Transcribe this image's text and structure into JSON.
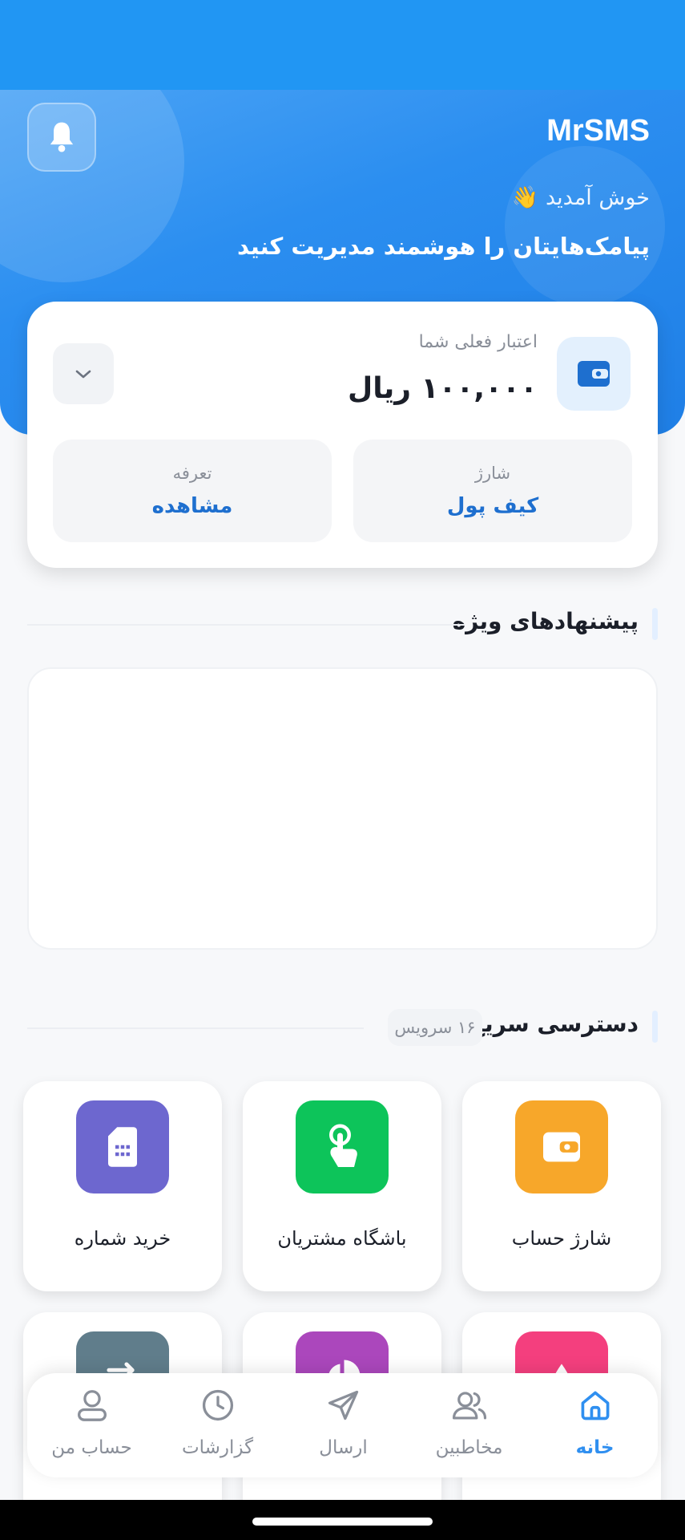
{
  "header": {
    "brand": "MrSMS",
    "welcome": "خوش آمدید 👋",
    "tagline": "پیامک‌هایتان را هوشمند مدیریت کنید"
  },
  "credit": {
    "label": "اعتبار فعلی شما",
    "amount": "۱۰۰,۰۰۰  ریال",
    "tiles": [
      {
        "caption": "شارژ",
        "value": "کیف پول"
      },
      {
        "caption": "تعرفه",
        "value": "مشاهده"
      }
    ]
  },
  "special_offers": {
    "title": "پیشنهادهای ویژه"
  },
  "quick_access": {
    "title": "دسترسی سریع",
    "count": "۱۶ سرویس",
    "services": [
      {
        "label": "شارژ حساب",
        "icon": "wallet-icon",
        "color": "#f7a72a"
      },
      {
        "label": "باشگاه مشتریان",
        "icon": "tap-icon",
        "color": "#0dc45a"
      },
      {
        "label": "خرید شماره",
        "icon": "sim-card-icon",
        "color": "#6d67cf"
      },
      {
        "label": "",
        "icon": "drop-icon",
        "color": "#f43f7e"
      },
      {
        "label": "",
        "icon": "pie-chart-icon",
        "color": "#ab47bc"
      },
      {
        "label": "",
        "icon": "transfer-icon",
        "color": "#607d8b"
      }
    ]
  },
  "nav": {
    "items": [
      {
        "label": "خانه",
        "icon": "home-icon",
        "active": true
      },
      {
        "label": "مخاطبین",
        "icon": "contacts-icon",
        "active": false
      },
      {
        "label": "ارسال",
        "icon": "send-icon",
        "active": false
      },
      {
        "label": "گزارشات",
        "icon": "clock-icon",
        "active": false
      },
      {
        "label": "حساب من",
        "icon": "user-icon",
        "active": false
      }
    ]
  },
  "colors": {
    "primary": "#2196f3",
    "accent_text": "#1e6fcf",
    "nav_active": "#2f8ff0"
  }
}
